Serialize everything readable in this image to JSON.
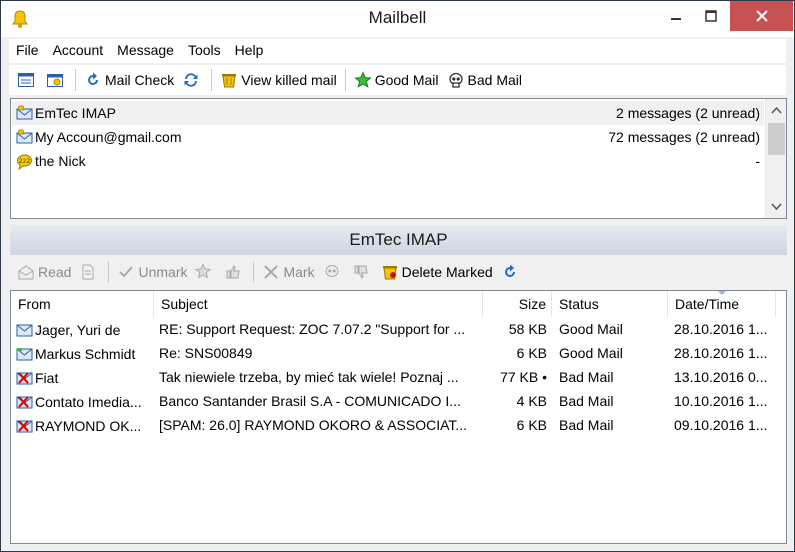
{
  "window": {
    "title": "Mailbell"
  },
  "menu": {
    "items": [
      "File",
      "Account",
      "Message",
      "Tools",
      "Help"
    ]
  },
  "toolbar": {
    "mail_check": "Mail Check",
    "view_killed": "View killed mail",
    "good_mail": "Good Mail",
    "bad_mail": "Bad Mail"
  },
  "accounts": [
    {
      "name": "EmTec IMAP",
      "count": "2 messages (2 unread)",
      "icon": "mailbell-envelope-icon",
      "selected": true
    },
    {
      "name": "My Accoun@gmail.com",
      "count": "72 messages (2 unread)",
      "icon": "mailbell-envelope-icon",
      "selected": false
    },
    {
      "name": "the Nick",
      "count": "-",
      "icon": "chat-bubble-icon",
      "selected": false
    }
  ],
  "panel": {
    "title": "EmTec IMAP"
  },
  "toolbar2": {
    "read": "Read",
    "unmark": "Unmark",
    "mark": "Mark",
    "delete_marked": "Delete Marked"
  },
  "table": {
    "columns": [
      "From",
      "Subject",
      "Size",
      "Status",
      "Date/Time"
    ],
    "rows": [
      {
        "from": "Jager, Yuri de",
        "subject": "RE: Support Request: ZOC 7.07.2 \"Support for ...",
        "size": "58 KB",
        "status": "Good Mail",
        "date": "28.10.2016 1...",
        "icon": "envelope-icon"
      },
      {
        "from": "Markus Schmidt",
        "subject": "Re: SNS00849",
        "size": "6 KB",
        "status": "Good Mail",
        "date": "28.10.2016 1...",
        "icon": "envelope-good-icon"
      },
      {
        "from": "Fiat",
        "subject": "Tak niewiele trzeba, by mieć tak wiele! Poznaj ...",
        "size": "77 KB •",
        "status": "Bad Mail",
        "date": "13.10.2016 0...",
        "icon": "envelope-bad-icon"
      },
      {
        "from": "Contato Imedia...",
        "subject": "Banco Santander Brasil S.A - COMUNICADO I...",
        "size": "4 KB",
        "status": "Bad Mail",
        "date": "10.10.2016 1...",
        "icon": "envelope-bad-icon"
      },
      {
        "from": "RAYMOND OK...",
        "subject": "[SPAM: 26.0] RAYMOND OKORO & ASSOCIAT...",
        "size": "6 KB",
        "status": "Bad Mail",
        "date": "09.10.2016 1...",
        "icon": "envelope-bad-icon"
      }
    ]
  },
  "colors": {
    "accent": "#1e6cc8",
    "close": "#c75050",
    "good": "#2aa02a",
    "bad": "#d01010"
  }
}
